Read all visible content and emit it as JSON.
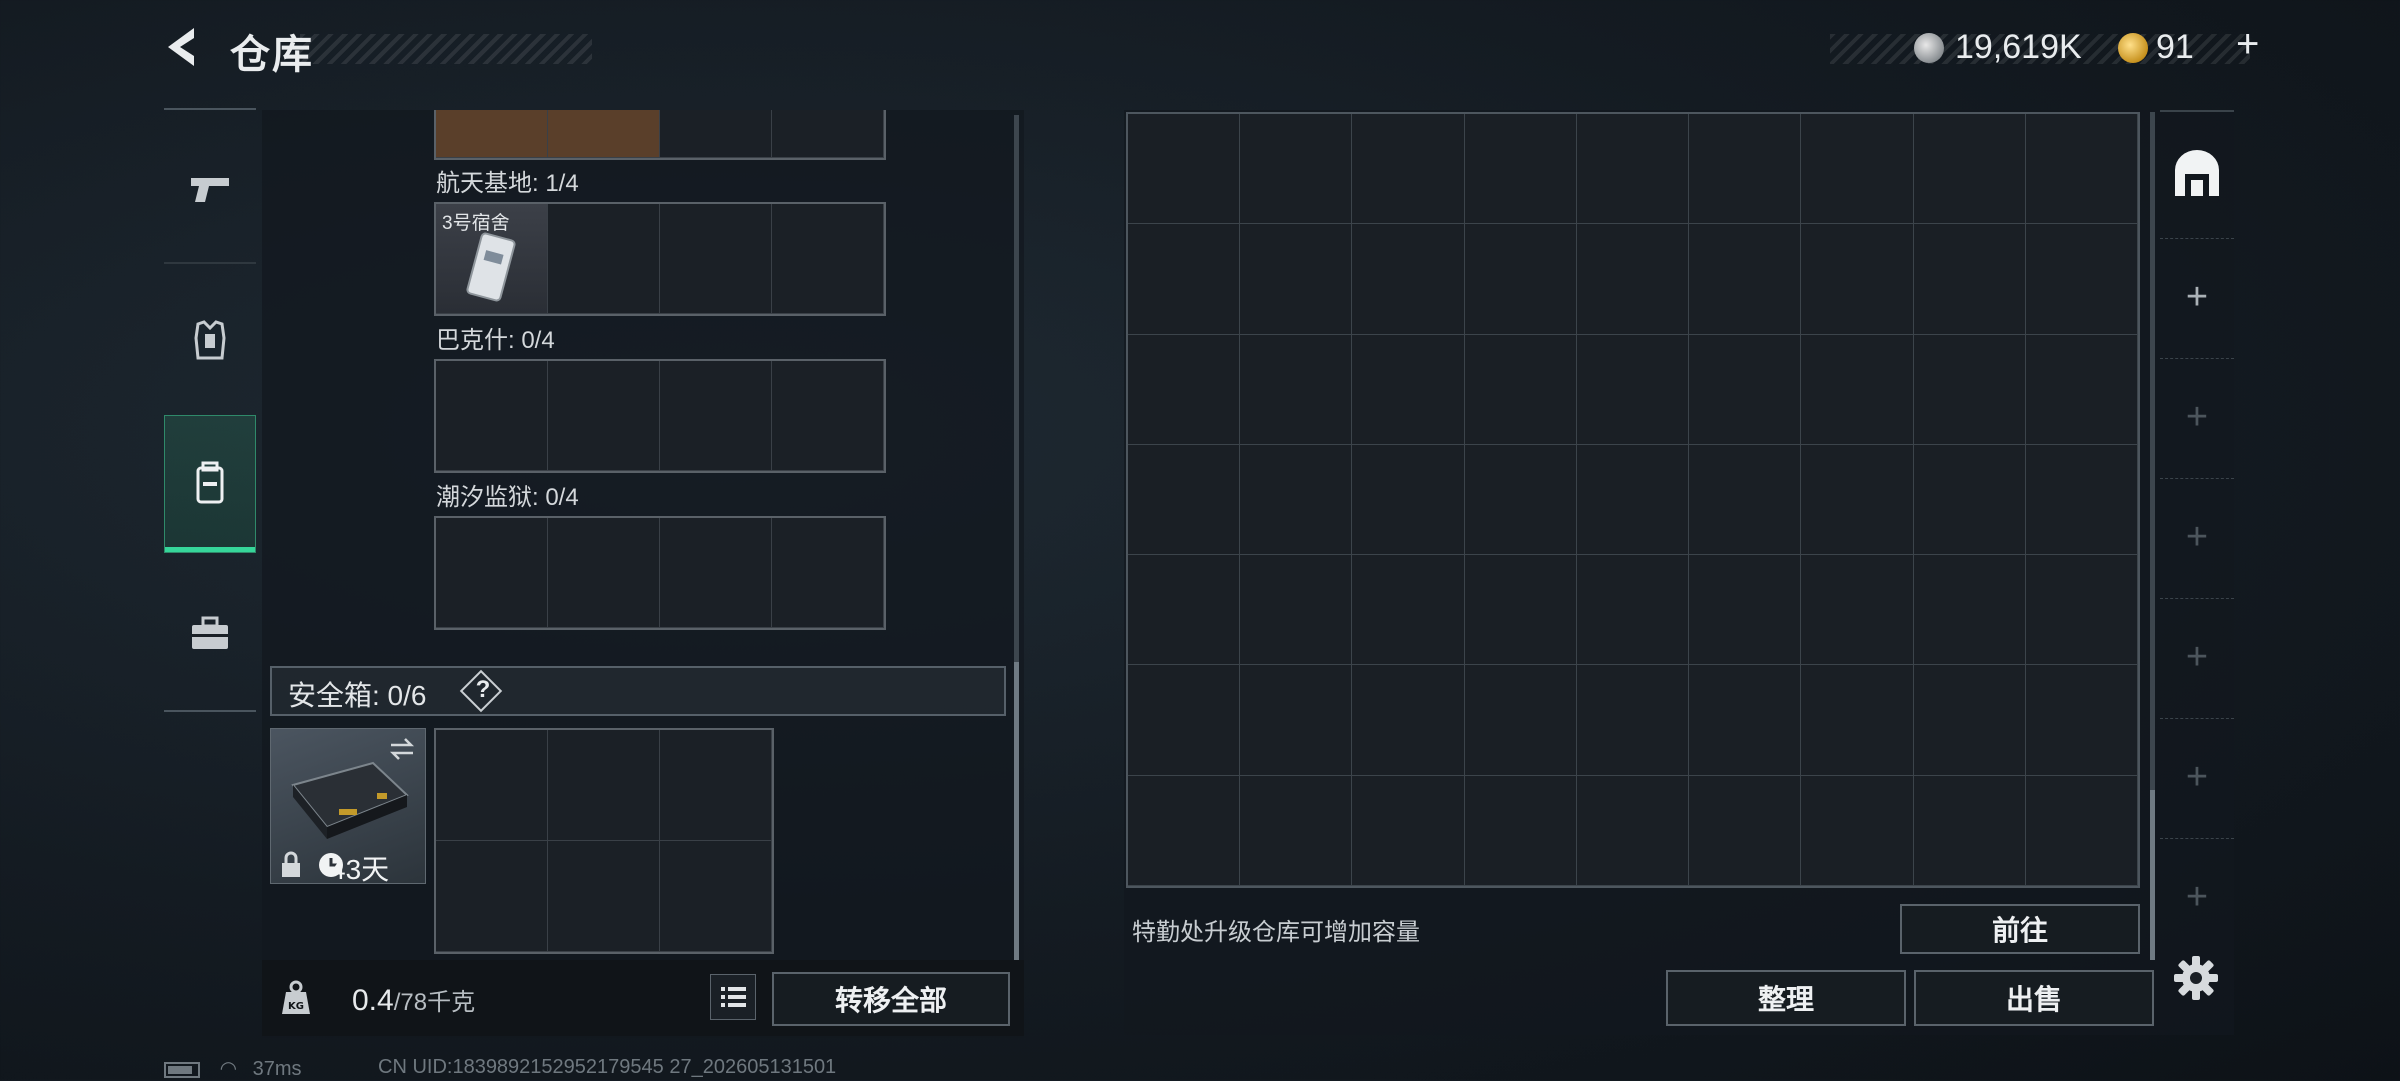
{
  "header": {
    "title": "仓库",
    "currency": [
      {
        "icon": "silver-coin-icon",
        "amount": "19,619K"
      },
      {
        "icon": "gold-coin-icon",
        "amount": "91"
      }
    ],
    "add_label": "+"
  },
  "left_nav": {
    "items": [
      {
        "name": "weapons",
        "icon": "pistol-icon"
      },
      {
        "name": "armor",
        "icon": "vest-icon"
      },
      {
        "name": "backpack",
        "icon": "backpack-icon",
        "active": true
      },
      {
        "name": "cases",
        "icon": "briefcase-icon"
      }
    ]
  },
  "key_groups": [
    {
      "label": "航天基地: 1/4",
      "item": "3号宿舍"
    },
    {
      "label": "巴克什: 0/4"
    },
    {
      "label": "潮汐监狱: 0/4"
    }
  ],
  "safe_box": {
    "label": "安全箱: 0/6",
    "help": "?",
    "days": "43天"
  },
  "weight": {
    "current": "0.4",
    "max": "/78千克"
  },
  "buttons": {
    "transfer_all": "转移全部",
    "goto": "前往",
    "sort": "整理",
    "sell": "出售"
  },
  "storage": {
    "hint": "特勤处升级仓库可增加容量",
    "columns": 9,
    "rows": 7
  },
  "right_nav": {
    "slots": [
      "+",
      "+",
      "+",
      "+",
      "+",
      "+"
    ]
  },
  "status_bar": {
    "ping": "37ms",
    "uid": "CN UID:1839892152952179545 27_202605131501"
  }
}
